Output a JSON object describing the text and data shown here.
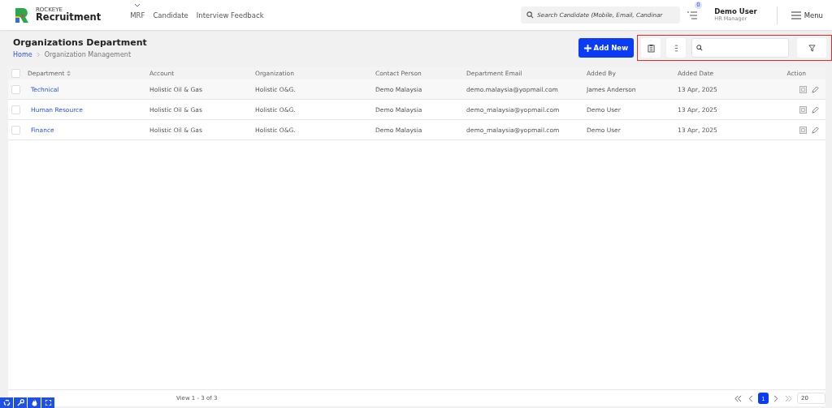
{
  "logo": {
    "top": "ROCKEYE",
    "bottom": "Recruitment"
  },
  "nav": [
    {
      "label": "MRF"
    },
    {
      "label": "Candidate"
    },
    {
      "label": "Interview Feedback"
    }
  ],
  "search": {
    "placeholder": "Search Candidate (Mobile, Email, Candinar"
  },
  "notifications": {
    "count": "0"
  },
  "user": {
    "name": "Demo User",
    "role": "HR Manager"
  },
  "menu": {
    "label": "Menu"
  },
  "page": {
    "title": "Organizations Department",
    "breadcrumb": [
      "Home",
      "Organization Management"
    ]
  },
  "toolbar": {
    "add_label": "Add New"
  },
  "table": {
    "select_all_checked": false,
    "columns": [
      "Department",
      "Account",
      "Organization",
      "Contact Person",
      "Department Email",
      "Added By",
      "Added Date",
      "Action"
    ],
    "rows": [
      {
        "checked": false,
        "cells": [
          "Technical",
          "Holistic Oil & Gas",
          "Holistic O&G.",
          "Demo Malaysia",
          "demo.malaysia@yopmail.com",
          "James Anderson",
          "13 Apr, 2025"
        ]
      },
      {
        "checked": false,
        "cells": [
          "Human Resource",
          "Holistic Oil & Gas",
          "Holistic O&G.",
          "Demo Malaysia",
          "demo_malaysia@yopmail.com",
          "Demo User",
          "13 Apr, 2025"
        ]
      },
      {
        "checked": false,
        "cells": [
          "Finance",
          "Holistic Oil & Gas",
          "Holistic O&G.",
          "Demo Malaysia",
          "demo_malaysia@yopmail.com",
          "Demo User",
          "13 Apr, 2025"
        ]
      }
    ]
  },
  "footer": {
    "view": "View 1 - 3 of 3",
    "pages": [
      {
        "label": "1",
        "selected": true
      }
    ],
    "page_size": "20"
  }
}
